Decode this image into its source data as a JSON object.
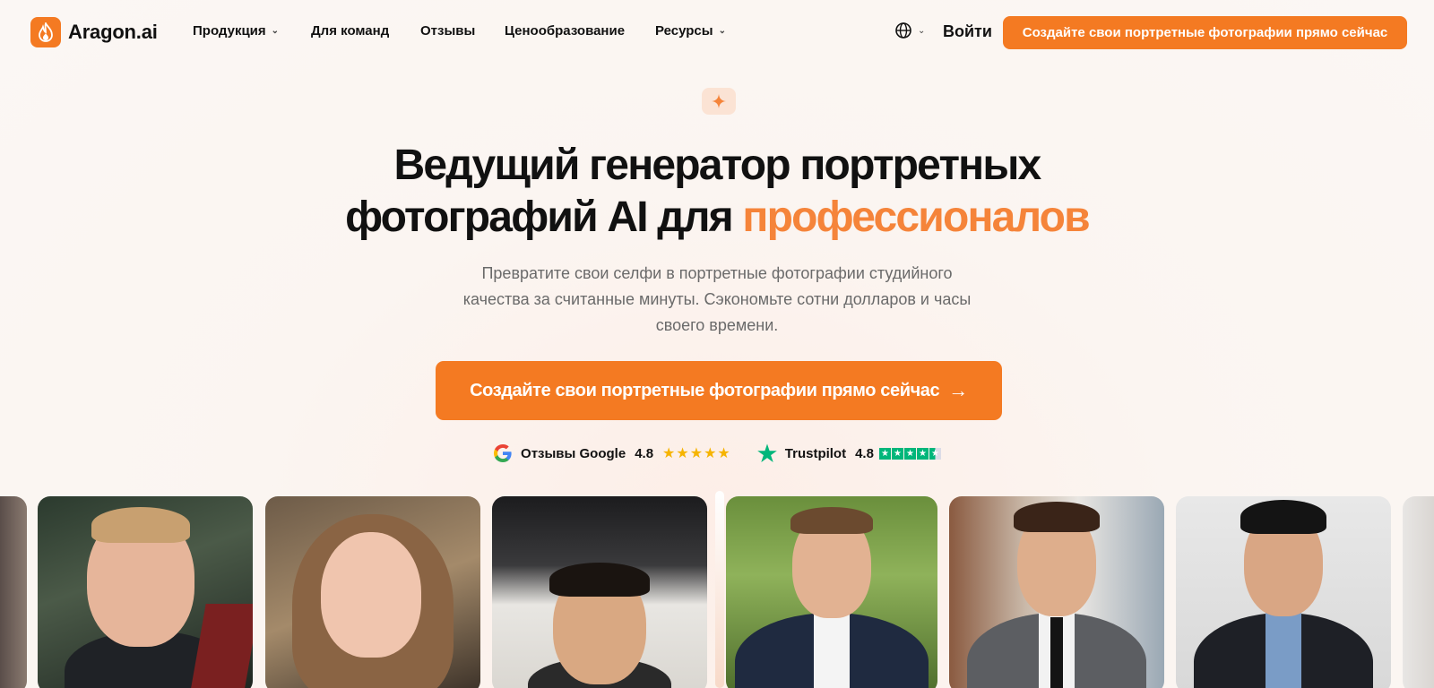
{
  "brand": {
    "name": "Aragon.ai",
    "icon": "flame-icon",
    "accent_color": "#f47a22"
  },
  "nav": {
    "items": [
      {
        "label": "Продукция",
        "has_dropdown": true
      },
      {
        "label": "Для команд",
        "has_dropdown": false
      },
      {
        "label": "Отзывы",
        "has_dropdown": false
      },
      {
        "label": "Ценообразование",
        "has_dropdown": false
      },
      {
        "label": "Ресурсы",
        "has_dropdown": true
      }
    ],
    "language_icon": "globe-icon",
    "login_label": "Войти",
    "cta_label": "Создайте свои портретные фотографии прямо сейчас"
  },
  "hero": {
    "badge_icon": "sparkle-icon",
    "title_line1": "Ведущий генератор портретных",
    "title_line2_prefix": "фотографий AI для ",
    "title_accent": "профессионалов",
    "accent_color": "#f5843a",
    "subtitle": "Превратите свои селфи в портретные фотографии студийного качества за считанные минуты. Сэкономьте сотни долларов и часы своего времени.",
    "cta_label": "Создайте свои портретные фотографии прямо сейчас",
    "cta_icon": "arrow-right-icon"
  },
  "ratings": [
    {
      "source": "Отзывы Google",
      "icon": "google-icon",
      "score": "4.8",
      "stars": 5,
      "star_color": "#f6b400"
    },
    {
      "source": "Trustpilot",
      "icon": "trustpilot-star-icon",
      "score": "4.8",
      "stars": 4.5,
      "star_color": "#00b67a"
    }
  ],
  "photos": {
    "before": [
      "selfie-car-man",
      "selfie-car-woman",
      "selfie-man-indoor"
    ],
    "after": [
      "portrait-park-man",
      "portrait-city-man",
      "portrait-studio-man"
    ]
  }
}
